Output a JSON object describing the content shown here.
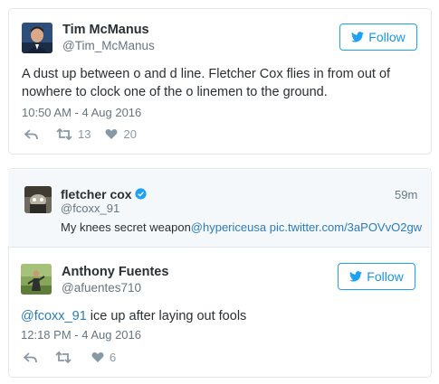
{
  "tweet1": {
    "name": "Tim McManus",
    "handle": "@Tim_McManus",
    "follow_label": "Follow",
    "text_line1": "A dust up between o and d line. Fletcher Cox flies in from out of",
    "text_line2": "nowhere to clock one of the o linemen to the ground.",
    "timestamp": "10:50 AM - 4 Aug 2016",
    "retweets": "13",
    "likes": "20"
  },
  "quoted": {
    "name": "fletcher cox",
    "handle": "@fcoxx_91",
    "time": "59m",
    "text_plain": "My knees secret weapon",
    "text_mention": "@hypericeusa",
    "text_link": "pic.twitter.com/3aPOVvO2gw"
  },
  "tweet2": {
    "name": "Anthony Fuentes",
    "handle": "@afuentes710",
    "follow_label": "Follow",
    "text_mention": "@fcoxx_91",
    "text_rest": " ice up after laying out fools",
    "timestamp": "12:18 PM - 4 Aug 2016",
    "likes": "6"
  },
  "colors": {
    "link": "#2b7bb9",
    "follow": "#1b95e0",
    "verified": "#1da1f2"
  }
}
